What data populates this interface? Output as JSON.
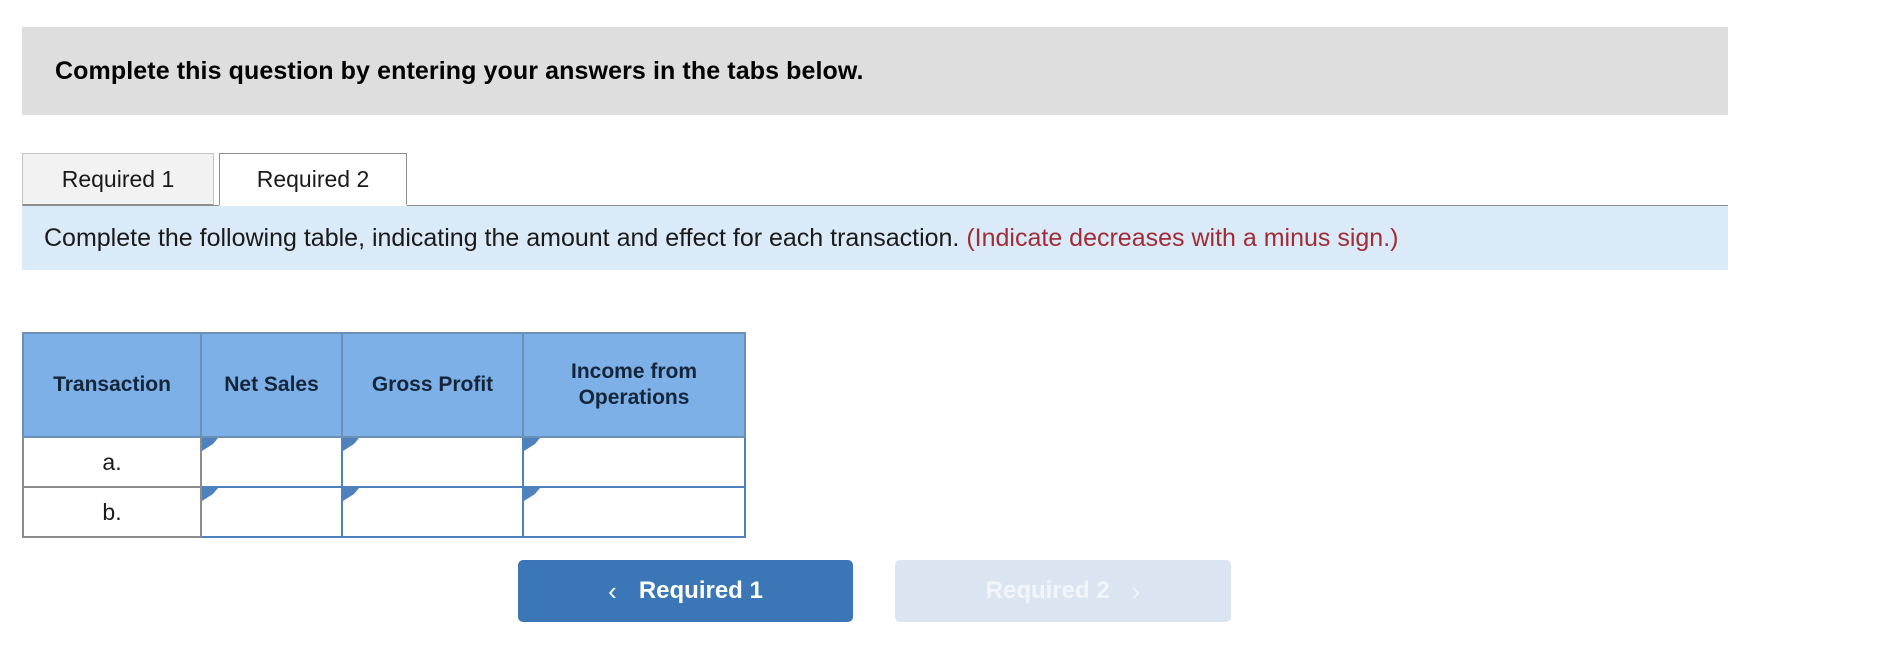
{
  "banner": {
    "text": "Complete this question by entering your answers in the tabs below."
  },
  "tabs": [
    {
      "label": "Required 1",
      "active": false
    },
    {
      "label": "Required 2",
      "active": true
    }
  ],
  "infobar": {
    "instruction": "Complete the following table, indicating the amount and effect for each transaction.",
    "note": "(Indicate decreases with a minus sign.)"
  },
  "table": {
    "headers": [
      "Transaction",
      "Net Sales",
      "Gross Profit",
      "Income from Operations"
    ],
    "rows": [
      {
        "transaction": "a.",
        "net_sales": "",
        "gross_profit": "",
        "income_from_operations": ""
      },
      {
        "transaction": "b.",
        "net_sales": "",
        "gross_profit": "",
        "income_from_operations": ""
      }
    ],
    "cell_placeholder": ""
  },
  "nav": {
    "prev_label": "Required 1",
    "next_label": "Required 2",
    "prev_icon": "chevron-left-icon",
    "next_icon": "chevron-right-icon",
    "prev_chevron": "‹",
    "next_chevron": "›"
  },
  "colors": {
    "banner_bg": "#dedede",
    "infobar_bg": "#daeaf8",
    "note_red": "#a02c35",
    "table_header_blue": "#7cb0e7",
    "input_border_blue": "#4f81bd",
    "primary_button": "#3b77b6",
    "disabled_button": "#dbe5f1"
  }
}
